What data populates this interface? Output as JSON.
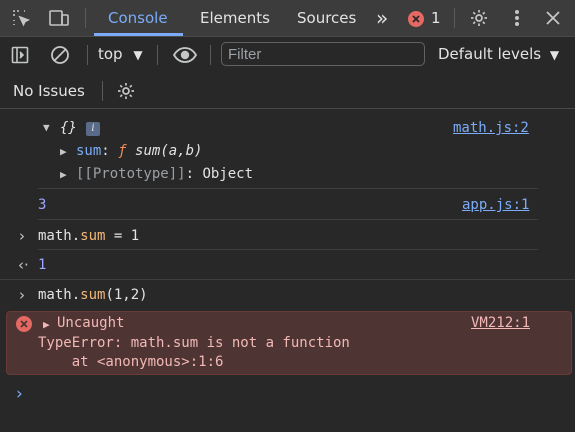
{
  "tabs": {
    "console": "Console",
    "elements": "Elements",
    "sources": "Sources",
    "more": "»",
    "error_count": "1"
  },
  "toolbar": {
    "context": "top",
    "filter_placeholder": "Filter",
    "levels": "Default levels"
  },
  "issues": {
    "label": "No Issues"
  },
  "console": {
    "obj_summary": "{}",
    "info_badge": "i",
    "obj_source": "math.js:2",
    "sum_key": "sum",
    "colon": ":",
    "f_glyph": "ƒ",
    "sum_sig": "sum(a,b)",
    "proto_label": "[[Prototype]]",
    "proto_value": "Object",
    "log_value": "3",
    "log_source": "app.js:1",
    "input1_prefix": "math.",
    "input1_prop": "sum",
    "input1_suffix": " = 1",
    "result1": "1",
    "input2_prefix": "math.",
    "input2_prop": "sum",
    "input2_suffix": "(1,2)",
    "uncaught": "Uncaught",
    "error_source": "VM212:1",
    "error_line1": "TypeError: math.sum is not a function",
    "error_line2": "    at <anonymous>:1:6"
  },
  "colors": {
    "accent": "#7cacf8",
    "error_red": "#e46962",
    "error_bg": "#4e3534"
  }
}
